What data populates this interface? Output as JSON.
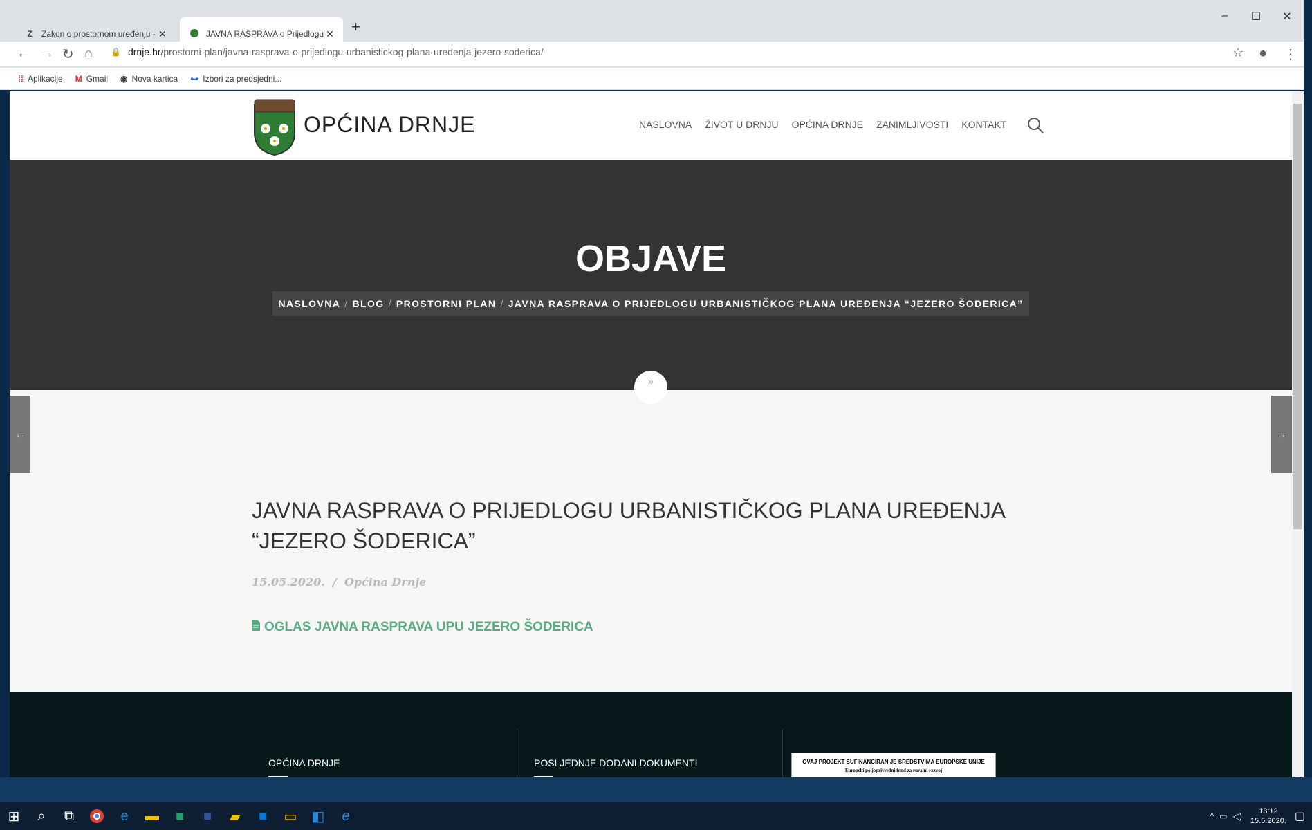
{
  "browser": {
    "tabs": [
      {
        "favicon": "Z",
        "title": "Zakon o prostornom uređenju - Z"
      },
      {
        "favicon": "shield",
        "title": "JAVNA RASPRAVA o Prijedlogu U"
      }
    ],
    "url_domain": "drnje.hr",
    "url_path": "/prostorni-plan/javna-rasprava-o-prijedlogu-urbanistickog-plana-uredenja-jezero-soderica/",
    "bookmarks": [
      {
        "icon": "apps-icon",
        "label": "Aplikacije"
      },
      {
        "icon": "gmail-icon",
        "label": "Gmail"
      },
      {
        "icon": "globe-icon",
        "label": "Nova kartica"
      },
      {
        "icon": "key-icon",
        "label": "Izbori za predsjedni..."
      }
    ]
  },
  "site": {
    "name": "OPĆINA DRNJE",
    "nav": [
      "NASLOVNA",
      "ŽIVOT U DRNJU",
      "OPĆINA DRNJE",
      "ZANIMLJIVOSTI",
      "KONTAKT"
    ],
    "hero_title": "OBJAVE",
    "breadcrumb": [
      "NASLOVNA",
      "BLOG",
      "PROSTORNI PLAN",
      "JAVNA RASPRAVA O PRIJEDLOGU URBANISTIČKOG PLANA UREĐENJA “JEZERO ŠODERICA”"
    ],
    "breadcrumb_sep": "/"
  },
  "post": {
    "title": "JAVNA RASPRAVA O PRIJEDLOGU URBANISTIČKOG PLANA UREĐENJA “JEZERO ŠODERICA”",
    "date": "15.05.2020.",
    "meta_sep": "/",
    "author": "Općina Drnje",
    "document_link": "OGLAS JAVNA RASPRAVA UPU JEZERO ŠODERICA"
  },
  "footer": {
    "col1_title": "OPĆINA DRNJE",
    "col2_title": "POSLJEDNJE DODANI DOKUMENTI",
    "eu_banner": "OVAJ PROJEKT SUFINANCIRAN JE SREDSTVIMA EUROPSKE UNIJE",
    "eu_banner_sub": "Europski poljoprivredni fond za ruralni razvoj"
  },
  "taskbar": {
    "time": "13:12",
    "date": "15.5.2020."
  },
  "colors": {
    "hero_bg": "#333333",
    "link_green": "#5aab84",
    "footer_bg": "#06181a"
  }
}
